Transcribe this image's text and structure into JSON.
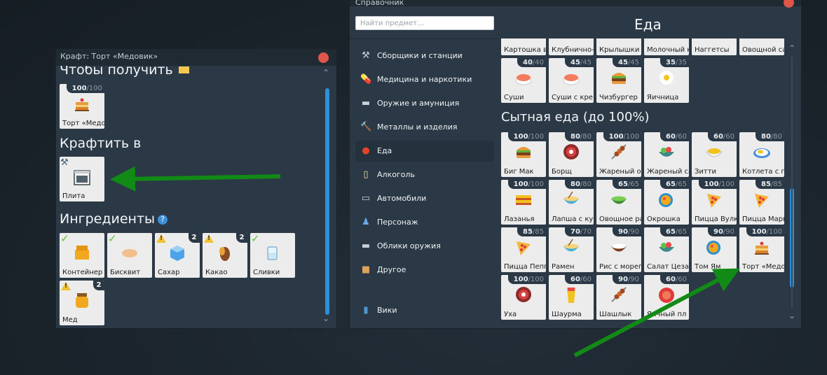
{
  "craft_window": {
    "title": "Крафт: Торт «Медовик»",
    "section_get": "Чтобы получить",
    "section_craft_in": "Крафтить в",
    "section_ingredients": "Ингредиенты",
    "help_symbol": "?",
    "result": {
      "label": "Торт «Медовик»",
      "count": "100",
      "max": "/100"
    },
    "station": {
      "label": "Плита"
    },
    "ingredients": [
      {
        "label": "Контейнер для еды",
        "status": "check",
        "qty": ""
      },
      {
        "label": "Бисквит",
        "status": "check",
        "qty": ""
      },
      {
        "label": "Сахар",
        "status": "warn",
        "qty": "2"
      },
      {
        "label": "Какао",
        "status": "warn",
        "qty": "2"
      },
      {
        "label": "Сливки",
        "status": "check",
        "qty": ""
      },
      {
        "label": "Мед",
        "status": "warn",
        "qty": "2"
      }
    ]
  },
  "reference_window": {
    "title": "Справочник",
    "search_placeholder": "Найти предмет…",
    "header": "Еда",
    "nav": [
      {
        "label": "Сборщики и станции",
        "icon": "tools-icon"
      },
      {
        "label": "Медицина и наркотики",
        "icon": "pill-icon"
      },
      {
        "label": "Оружие и амуниция",
        "icon": "gun-icon"
      },
      {
        "label": "Металлы и изделия",
        "icon": "hammer-icon"
      },
      {
        "label": "Еда",
        "icon": "apple-icon",
        "active": true
      },
      {
        "label": "Алкоголь",
        "icon": "cup-icon"
      },
      {
        "label": "Автомобили",
        "icon": "car-icon"
      },
      {
        "label": "Персонаж",
        "icon": "person-icon"
      },
      {
        "label": "Облики оружия",
        "icon": "gun-skin-icon"
      },
      {
        "label": "Другое",
        "icon": "box-icon"
      }
    ],
    "wiki_label": "Вики",
    "partial_row": [
      "Картошка в",
      "Клубнично-",
      "Крылышки",
      "Молочный к",
      "Наггетсы",
      "Овощной са"
    ],
    "snacks_row": [
      {
        "label": "Суши",
        "count": "40",
        "max": "/40",
        "icon": "sushi"
      },
      {
        "label": "Суши с кре",
        "count": "45",
        "max": "/45",
        "icon": "sushi"
      },
      {
        "label": "Чизбургер",
        "count": "45",
        "max": "/45",
        "icon": "burger"
      },
      {
        "label": "Яичница",
        "count": "35",
        "max": "/35",
        "icon": "egg"
      }
    ],
    "category_title": "Сытная еда (до 100%)",
    "items": [
      {
        "label": "Биг Мак",
        "count": "100",
        "max": "/100",
        "icon": "burger"
      },
      {
        "label": "Борщ",
        "count": "80",
        "max": "/80",
        "icon": "borsch"
      },
      {
        "label": "Жареный ок",
        "count": "100",
        "max": "/100",
        "icon": "skewer"
      },
      {
        "label": "Жареный са",
        "count": "60",
        "max": "/60",
        "icon": "salad"
      },
      {
        "label": "Зитти",
        "count": "60",
        "max": "/60",
        "icon": "pasta"
      },
      {
        "label": "Котлета с п",
        "count": "80",
        "max": "/80",
        "icon": "plate"
      },
      {
        "label": "Лазанья",
        "count": "100",
        "max": "/100",
        "icon": "lasagna"
      },
      {
        "label": "Лапша с кур",
        "count": "80",
        "max": "/80",
        "icon": "noodles"
      },
      {
        "label": "Овощное ра",
        "count": "65",
        "max": "/65",
        "icon": "bowl-green"
      },
      {
        "label": "Окрошка",
        "count": "65",
        "max": "/65",
        "icon": "pan"
      },
      {
        "label": "Пицца Вулк",
        "count": "100",
        "max": "/100",
        "icon": "pizza"
      },
      {
        "label": "Пицца Марг",
        "count": "85",
        "max": "/85",
        "icon": "pizza"
      },
      {
        "label": "Пицца Пепп",
        "count": "85",
        "max": "/85",
        "icon": "pizza"
      },
      {
        "label": "Рамен",
        "count": "70",
        "max": "/70",
        "icon": "noodles"
      },
      {
        "label": "Рис с морепр",
        "count": "90",
        "max": "/90",
        "icon": "rice"
      },
      {
        "label": "Салат Цеза",
        "count": "65",
        "max": "/65",
        "icon": "salad"
      },
      {
        "label": "Том Ям",
        "count": "90",
        "max": "/90",
        "icon": "pan"
      },
      {
        "label": "Торт «Медо",
        "count": "100",
        "max": "/100",
        "icon": "cake"
      },
      {
        "label": "Уха",
        "count": "100",
        "max": "/100",
        "icon": "borsch"
      },
      {
        "label": "Шаурма",
        "count": "60",
        "max": "/60",
        "icon": "wrap"
      },
      {
        "label": "Шашлык",
        "count": "90",
        "max": "/90",
        "icon": "skewer"
      },
      {
        "label": "Яичный пл",
        "count": "60",
        "max": "/60",
        "icon": "rice-red"
      }
    ]
  },
  "colors": {
    "accent": "#2d8fd8",
    "close": "#e0564a",
    "arrow": "#128a16",
    "panel": "#2a3945"
  }
}
